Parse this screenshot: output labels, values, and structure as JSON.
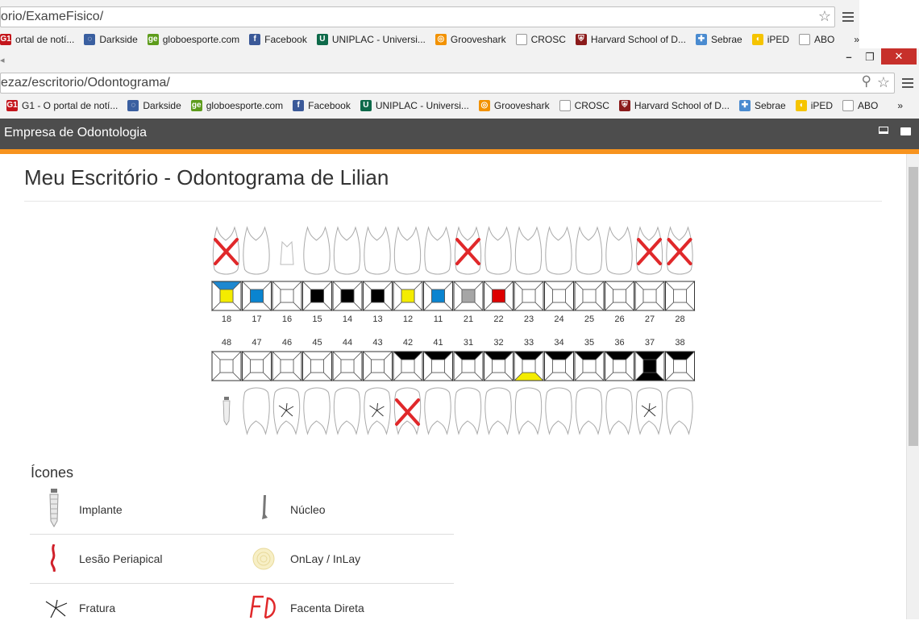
{
  "background_browser": {
    "url": "orio/ExameFisico/",
    "bookmarks": [
      "ortal de notí...",
      "Darkside",
      "globoesporte.com",
      "Facebook",
      "UNIPLAC - Universi...",
      "Grooveshark",
      "CROSC",
      "Harvard School of D...",
      "Sebrae",
      "iPED",
      "ABO"
    ],
    "more": "»"
  },
  "browser": {
    "url": "ezaz/escritorio/Odontograma/",
    "bookmarks": [
      "G1 - O portal de notí...",
      "Darkside",
      "globoesporte.com",
      "Facebook",
      "UNIPLAC - Universi...",
      "Grooveshark",
      "CROSC",
      "Harvard School of D...",
      "Sebrae",
      "iPED",
      "ABO"
    ],
    "more": "»",
    "minimize": "–",
    "restore": "❐",
    "close": "✕"
  },
  "navbar": {
    "brand": "Empresa de Odontologia"
  },
  "page": {
    "title": "Meu Escritório - Odontograma de Lilian"
  },
  "odontogram": {
    "upper_numbers": [
      "18",
      "17",
      "16",
      "15",
      "14",
      "13",
      "12",
      "11",
      "21",
      "22",
      "23",
      "24",
      "25",
      "26",
      "27",
      "28"
    ],
    "lower_numbers": [
      "48",
      "47",
      "46",
      "45",
      "44",
      "43",
      "42",
      "41",
      "31",
      "32",
      "33",
      "34",
      "35",
      "36",
      "37",
      "38"
    ],
    "upper_crown_markers": [
      "missing",
      "normal",
      "small",
      "normal",
      "normal",
      "normal",
      "normal",
      "normal",
      "missing",
      "normal",
      "normal",
      "normal",
      "normal",
      "normal",
      "missing",
      "missing"
    ],
    "lower_crown_markers": [
      "implant",
      "normal",
      "fracture",
      "normal",
      "normal",
      "fracture",
      "missing",
      "normal",
      "normal",
      "normal",
      "normal",
      "normal",
      "normal",
      "normal",
      "fracture",
      "normal"
    ],
    "upper_face_colors": [
      {
        "top": "#1e88d0",
        "center": "#f4ec00"
      },
      {
        "top": "",
        "center": "#0a84d0"
      },
      {
        "top": "",
        "center": ""
      },
      {
        "top": "",
        "center": "#000000"
      },
      {
        "top": "",
        "center": "#000000"
      },
      {
        "top": "",
        "center": "#000000"
      },
      {
        "top": "",
        "center": "#f4ec00"
      },
      {
        "top": "",
        "center": "#0a84d0"
      },
      {
        "top": "",
        "center": "#a6a6a6"
      },
      {
        "top": "",
        "center": "#dd0000"
      },
      {
        "top": "",
        "center": ""
      },
      {
        "top": "",
        "center": ""
      },
      {
        "top": "",
        "center": ""
      },
      {
        "top": "",
        "center": ""
      },
      {
        "top": "",
        "center": ""
      },
      {
        "top": "",
        "center": ""
      }
    ],
    "lower_face_colors": [
      {
        "top": "",
        "bottom": "",
        "center": ""
      },
      {
        "top": "",
        "bottom": "",
        "center": ""
      },
      {
        "top": "",
        "bottom": "",
        "center": ""
      },
      {
        "top": "",
        "bottom": "",
        "center": ""
      },
      {
        "top": "",
        "bottom": "",
        "center": ""
      },
      {
        "top": "",
        "bottom": "",
        "center": ""
      },
      {
        "top": "#000000",
        "bottom": "",
        "center": ""
      },
      {
        "top": "#000000",
        "bottom": "",
        "center": ""
      },
      {
        "top": "#000000",
        "bottom": "",
        "center": ""
      },
      {
        "top": "#000000",
        "bottom": "",
        "center": ""
      },
      {
        "top": "#000000",
        "bottom": "#f4ec00",
        "center": ""
      },
      {
        "top": "#000000",
        "bottom": "",
        "center": ""
      },
      {
        "top": "#000000",
        "bottom": "",
        "center": ""
      },
      {
        "top": "#000000",
        "bottom": "",
        "center": ""
      },
      {
        "top": "#000000",
        "bottom": "#000000",
        "center": "#000000"
      },
      {
        "top": "#000000",
        "bottom": "",
        "center": ""
      }
    ]
  },
  "legend": {
    "heading": "Ícones",
    "items": [
      {
        "label": "Implante",
        "icon": "implant-icon"
      },
      {
        "label": "Núcleo",
        "icon": "nucleus-icon"
      },
      {
        "label": "Lesão Periapical",
        "icon": "periapical-lesion-icon"
      },
      {
        "label": "OnLay / InLay",
        "icon": "onlay-inlay-icon"
      },
      {
        "label": "Fratura",
        "icon": "fracture-icon"
      },
      {
        "label": "Facenta Direta",
        "icon": "facenta-direta-icon"
      }
    ]
  },
  "colors": {
    "navbar": "#4d4d4d",
    "accent": "#f7931e",
    "x_mark": "#e0282a"
  }
}
